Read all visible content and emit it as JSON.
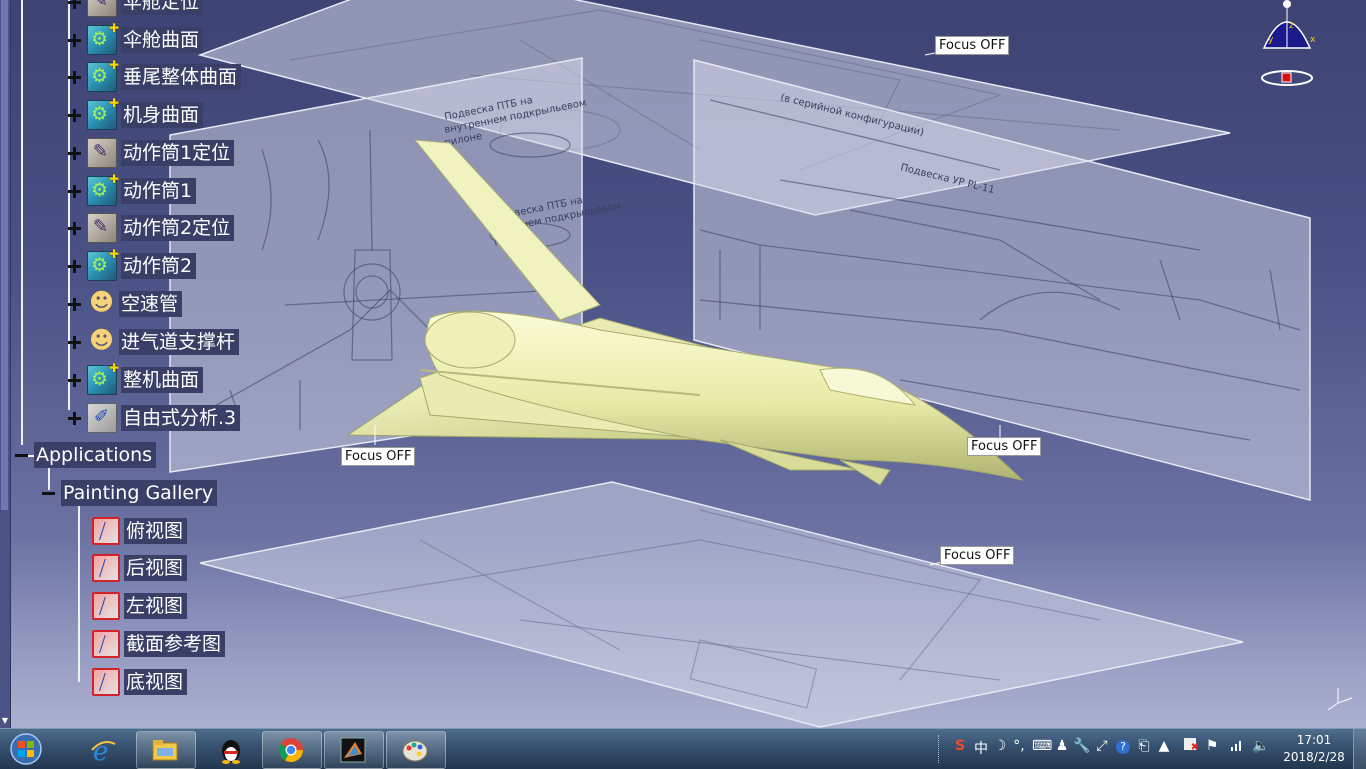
{
  "tree": {
    "nodes": [
      {
        "label": "伞舱定位",
        "icon": "sketch-icon"
      },
      {
        "label": "伞舱曲面",
        "icon": "part-icon"
      },
      {
        "label": "垂尾整体曲面",
        "icon": "part-icon"
      },
      {
        "label": "机身曲面",
        "icon": "part-icon"
      },
      {
        "label": "动作筒1定位",
        "icon": "sketch-icon"
      },
      {
        "label": "动作筒1",
        "icon": "part-icon"
      },
      {
        "label": "动作筒2定位",
        "icon": "sketch-icon"
      },
      {
        "label": "动作筒2",
        "icon": "part-icon"
      },
      {
        "label": "空速管",
        "icon": "user-icon"
      },
      {
        "label": "进气道支撑杆",
        "icon": "user-icon"
      },
      {
        "label": "整机曲面",
        "icon": "part-icon"
      },
      {
        "label": "自由式分析.3",
        "icon": "analysis-icon"
      }
    ],
    "applications_label": "Applications",
    "painting_gallery_label": "Painting Gallery",
    "gallery_items": [
      {
        "label": "俯视图"
      },
      {
        "label": "后视图"
      },
      {
        "label": "左视图"
      },
      {
        "label": "截面参考图"
      },
      {
        "label": "底视图"
      }
    ]
  },
  "viewport": {
    "focus_tags": [
      "Focus OFF",
      "Focus OFF",
      "Focus OFF",
      "Focus OFF"
    ],
    "blueprint_texts": {
      "left_1": "Подвеска ПТБ на",
      "left_2": "внутреннем подкрыльевом",
      "left_3": "пилоне",
      "left_4": "Подвеска ПТБ на",
      "left_5": "внешнем подкрыльевом",
      "left_6": "пилоне",
      "right_1": "(в серийной конфигурации)",
      "right_2": "Подвеска УР PL-11"
    },
    "compass_axes": {
      "x": "x",
      "y": "y",
      "z": "z"
    },
    "model_color": "#eef0b2",
    "background_top": "#3d4373",
    "background_bottom": "#b7bbd7"
  },
  "taskbar": {
    "pinned": [
      "ie-icon",
      "explorer-icon",
      "qq-icon",
      "chrome-icon",
      "catia-app-icon",
      "paint-icon"
    ],
    "tray": {
      "ime_label": "中",
      "moon": "☽",
      "punct": "°,",
      "keyboard": "⌨"
    },
    "clock_time": "17:01",
    "clock_date": "2018/2/28"
  }
}
